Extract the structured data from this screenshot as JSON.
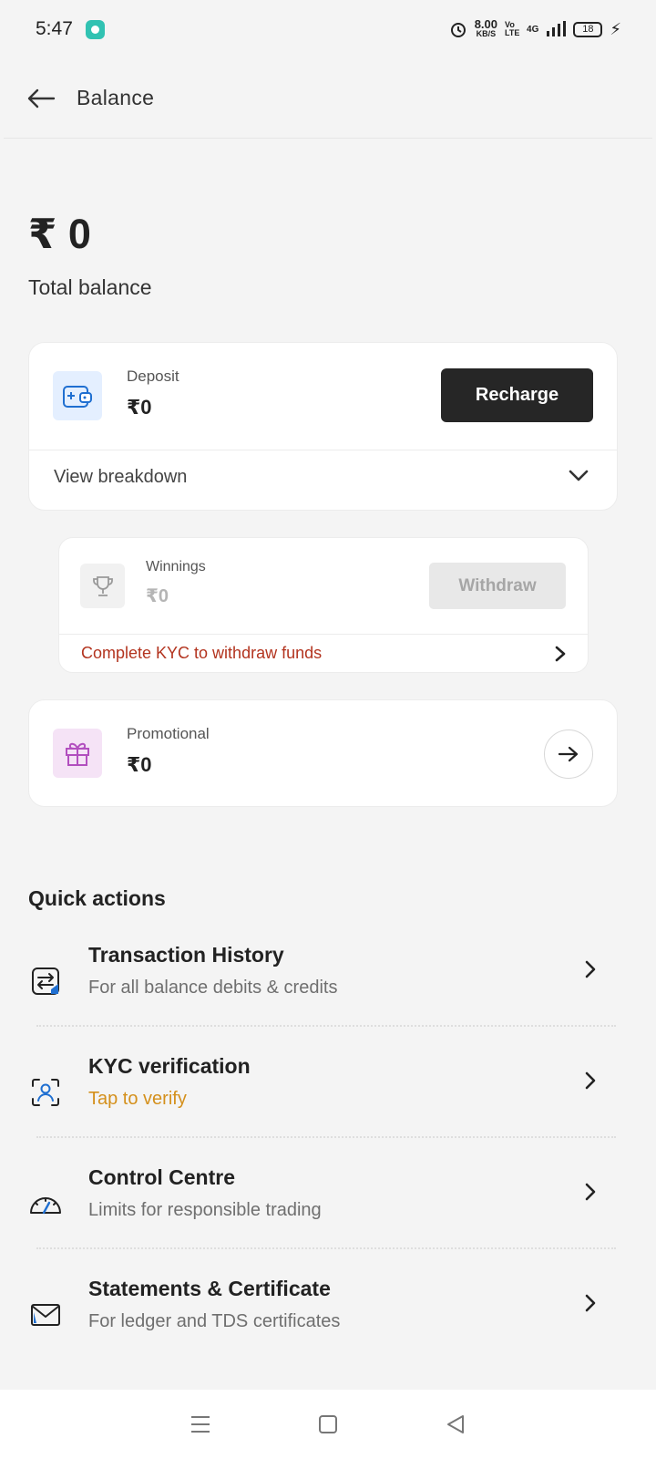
{
  "status_bar": {
    "time": "5:47",
    "net_speed": "8.00",
    "net_unit": "KB/S",
    "volte": "Vo LTE",
    "network": "4G",
    "battery": "18"
  },
  "header": {
    "title": "Balance"
  },
  "balance": {
    "amount": "₹ 0",
    "label": "Total balance"
  },
  "deposit": {
    "label": "Deposit",
    "value": "₹0",
    "button": "Recharge",
    "breakdown": "View breakdown",
    "icon": "wallet-plus-icon"
  },
  "winnings": {
    "label": "Winnings",
    "value": "₹0",
    "button": "Withdraw",
    "kyc_notice": "Complete KYC to withdraw funds",
    "icon": "trophy-icon"
  },
  "promotional": {
    "label": "Promotional",
    "value": "₹0",
    "icon": "gift-icon"
  },
  "quick_actions": {
    "title": "Quick actions",
    "items": [
      {
        "title": "Transaction History",
        "subtitle": "For all balance debits & credits",
        "icon": "transfer-icon"
      },
      {
        "title": "KYC verification",
        "subtitle": "Tap to verify",
        "icon": "user-scan-icon"
      },
      {
        "title": "Control Centre",
        "subtitle": "Limits for responsible trading",
        "icon": "gauge-icon"
      },
      {
        "title": "Statements & Certificate",
        "subtitle": "For ledger and TDS certificates",
        "icon": "mail-icon"
      }
    ]
  },
  "colors": {
    "accent_blue": "#1f6fd1",
    "warning_red": "#b3341f",
    "verify_orange": "#d4901c",
    "button_dark": "#262626"
  }
}
